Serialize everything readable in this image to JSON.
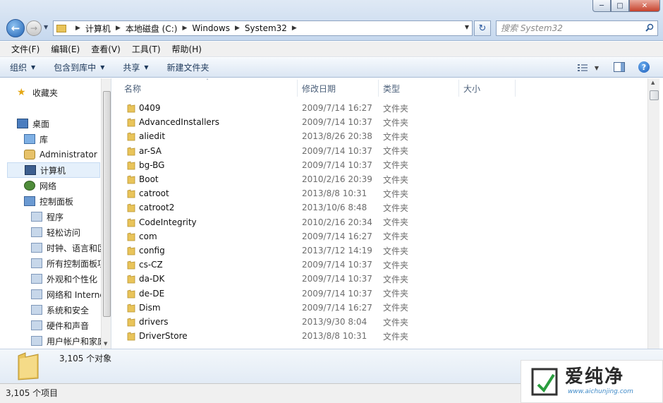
{
  "window": {
    "minimize_icon": "minimize-icon",
    "maximize_icon": "maximize-icon",
    "close_icon": "close-icon"
  },
  "address": {
    "breadcrumbs": [
      "计算机",
      "本地磁盘 (C:)",
      "Windows",
      "System32"
    ]
  },
  "search": {
    "placeholder": "搜索 System32"
  },
  "menu": [
    "文件(F)",
    "编辑(E)",
    "查看(V)",
    "工具(T)",
    "帮助(H)"
  ],
  "toolbar": {
    "organize": "组织",
    "include_in_library": "包含到库中",
    "share": "共享",
    "new_folder": "新建文件夹"
  },
  "sidebar": {
    "items": [
      {
        "label": "收藏夹",
        "icon": "star-icon"
      },
      {
        "label": "桌面",
        "icon": "desktop-icon"
      },
      {
        "label": "库",
        "icon": "library-icon"
      },
      {
        "label": "Administrator",
        "icon": "user-icon"
      },
      {
        "label": "计算机",
        "icon": "computer-icon"
      },
      {
        "label": "网络",
        "icon": "network-icon"
      },
      {
        "label": "控制面板",
        "icon": "control-panel-icon"
      },
      {
        "label": "程序",
        "icon": "programs-icon"
      },
      {
        "label": "轻松访问",
        "icon": "ease-of-access-icon"
      },
      {
        "label": "时钟、语言和区",
        "icon": "clock-language-icon"
      },
      {
        "label": "所有控制面板项",
        "icon": "all-control-panel-icon"
      },
      {
        "label": "外观和个性化",
        "icon": "appearance-icon"
      },
      {
        "label": "网络和 Interne",
        "icon": "network-internet-icon"
      },
      {
        "label": "系统和安全",
        "icon": "system-security-icon"
      },
      {
        "label": "硬件和声音",
        "icon": "hardware-sound-icon"
      },
      {
        "label": "用户帐户和家庭",
        "icon": "user-accounts-icon"
      }
    ]
  },
  "columns": {
    "name": "名称",
    "date": "修改日期",
    "type": "类型",
    "size": "大小"
  },
  "files": [
    {
      "name": "0409",
      "date": "2009/7/14 16:27",
      "type": "文件夹"
    },
    {
      "name": "AdvancedInstallers",
      "date": "2009/7/14 10:37",
      "type": "文件夹"
    },
    {
      "name": "aliedit",
      "date": "2013/8/26 20:38",
      "type": "文件夹"
    },
    {
      "name": "ar-SA",
      "date": "2009/7/14 10:37",
      "type": "文件夹"
    },
    {
      "name": "bg-BG",
      "date": "2009/7/14 10:37",
      "type": "文件夹"
    },
    {
      "name": "Boot",
      "date": "2010/2/16 20:39",
      "type": "文件夹"
    },
    {
      "name": "catroot",
      "date": "2013/8/8 10:31",
      "type": "文件夹"
    },
    {
      "name": "catroot2",
      "date": "2013/10/6 8:48",
      "type": "文件夹"
    },
    {
      "name": "CodeIntegrity",
      "date": "2010/2/16 20:34",
      "type": "文件夹"
    },
    {
      "name": "com",
      "date": "2009/7/14 16:27",
      "type": "文件夹"
    },
    {
      "name": "config",
      "date": "2013/7/12 14:19",
      "type": "文件夹"
    },
    {
      "name": "cs-CZ",
      "date": "2009/7/14 10:37",
      "type": "文件夹"
    },
    {
      "name": "da-DK",
      "date": "2009/7/14 10:37",
      "type": "文件夹"
    },
    {
      "name": "de-DE",
      "date": "2009/7/14 10:37",
      "type": "文件夹"
    },
    {
      "name": "Dism",
      "date": "2009/7/14 16:27",
      "type": "文件夹"
    },
    {
      "name": "drivers",
      "date": "2013/9/30 8:04",
      "type": "文件夹"
    },
    {
      "name": "DriverStore",
      "date": "2013/8/8 10:31",
      "type": "文件夹"
    }
  ],
  "details": {
    "count": "3,105 个对象"
  },
  "status": {
    "text": "3,105 个项目"
  },
  "watermark": {
    "text": "爱纯净",
    "url": "www.aichunjing.com"
  },
  "colors": {
    "accent": "#1f62b4",
    "folder": "#e9c45a"
  }
}
